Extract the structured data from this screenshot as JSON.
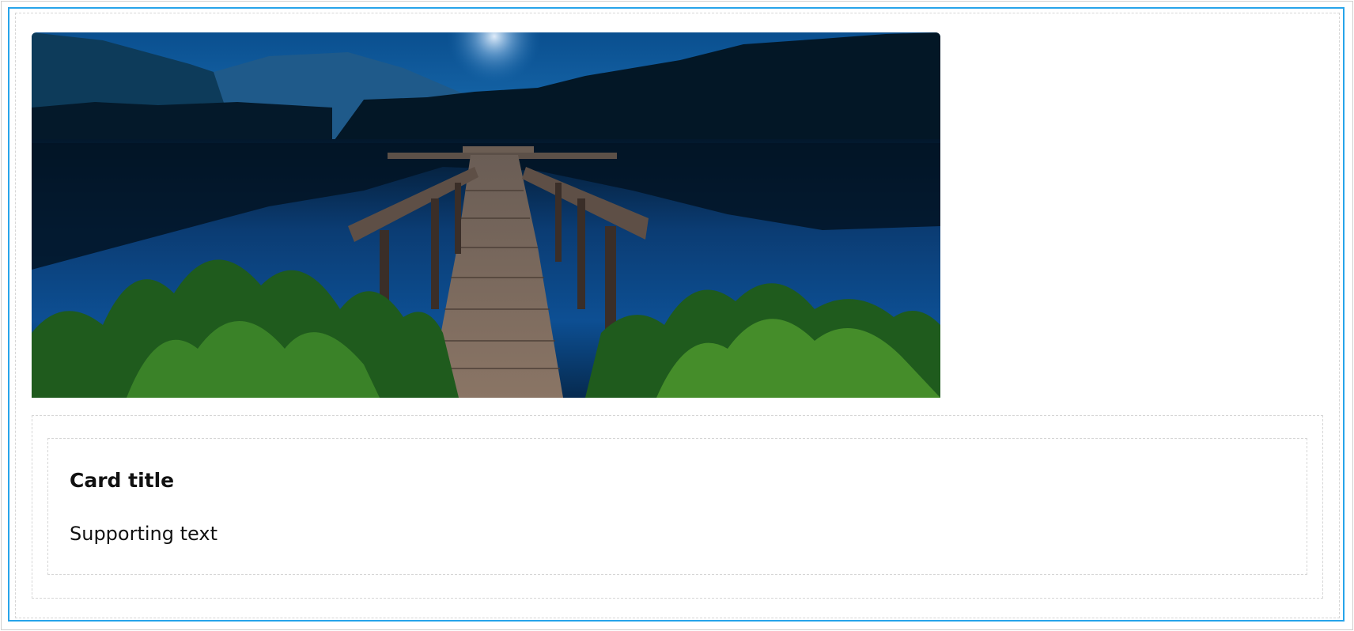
{
  "card": {
    "title": "Card title",
    "supporting_text": "Supporting text",
    "media": {
      "description_icon": "lake-dock-night-image"
    }
  },
  "colors": {
    "card_border": "#27a4ea",
    "dashed_outline": "#d6d6d6",
    "text": "#111111"
  }
}
